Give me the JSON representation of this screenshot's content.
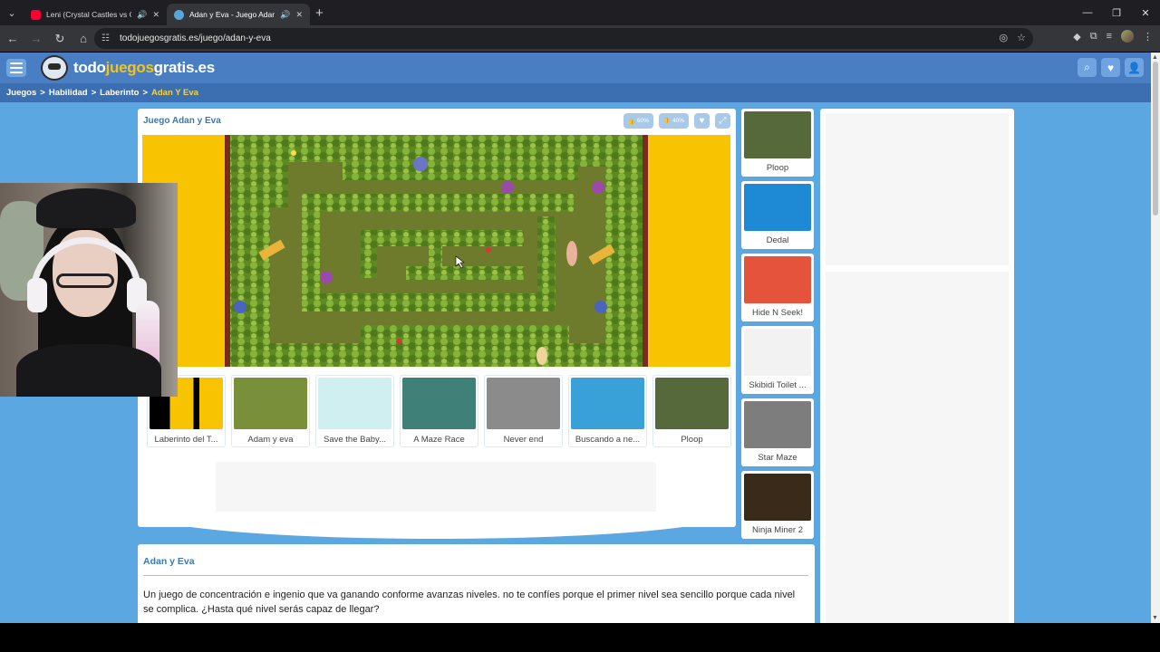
{
  "browser": {
    "tabs": [
      {
        "title": "Leni (Crystal Castles vs Goo",
        "active": false,
        "icon": "youtube-icon"
      },
      {
        "title": "Adan y Eva - Juego Adan y",
        "active": true,
        "icon": "site-favicon"
      }
    ],
    "url": "todojuegosgratis.es/juego/adan-y-eva"
  },
  "site": {
    "logo_main": "todo",
    "logo_accent": "juegos",
    "logo_tail": "gratis.es"
  },
  "breadcrumb": {
    "items": [
      "Juegos",
      "Habilidad",
      "Laberinto"
    ],
    "separator": ">",
    "current": "Adan Y Eva"
  },
  "game": {
    "title": "Juego Adan y Eva",
    "like_pct": "60%",
    "dislike_pct": "40%"
  },
  "related": [
    {
      "label": "Laberinto del T...",
      "color": "#f8c300"
    },
    {
      "label": "Adam y eva",
      "color": "#7a8f3a"
    },
    {
      "label": "Save the Baby...",
      "color": "#cfeff0"
    },
    {
      "label": "A Maze Race",
      "color": "#3f8078"
    },
    {
      "label": "Never end",
      "color": "#8b8b8b"
    },
    {
      "label": "Buscando a ne...",
      "color": "#3aa0d8"
    },
    {
      "label": "Ploop",
      "color": "#55693a"
    }
  ],
  "sidebar_games": [
    {
      "label": "Ploop",
      "color": "#55693a"
    },
    {
      "label": "Dedal",
      "color": "#1e8ad6"
    },
    {
      "label": "Hide N Seek!",
      "color": "#e6533c"
    },
    {
      "label": "Skibidi Toilet ...",
      "color": "#f2f2f2"
    },
    {
      "label": "Star Maze",
      "color": "#7d7d7d"
    },
    {
      "label": "Ninja Miner 2",
      "color": "#3a2a1a"
    }
  ],
  "description": {
    "title": "Adan y Eva",
    "text": "Un juego de concentración e ingenio que va ganando conforme avanzas niveles. no te confíes porque el primer nivel sea sencillo porque cada nivel se complica. ¿Hasta qué nivel serás capaz de llegar?"
  }
}
